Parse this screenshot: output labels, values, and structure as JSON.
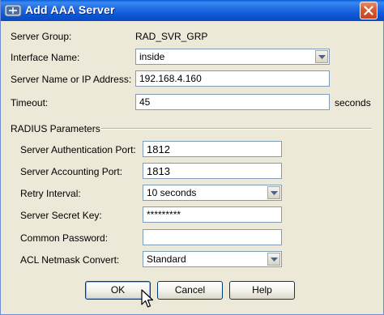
{
  "window": {
    "title": "Add AAA Server"
  },
  "form": {
    "server_group": {
      "label": "Server Group:",
      "value": "RAD_SVR_GRP"
    },
    "interface_name": {
      "label": "Interface Name:",
      "value": "inside"
    },
    "server_name": {
      "label": "Server Name or IP Address:",
      "value": "192.168.4.160"
    },
    "timeout": {
      "label": "Timeout:",
      "value": "45",
      "unit": "seconds"
    }
  },
  "radius": {
    "section_label": "RADIUS Parameters",
    "auth_port": {
      "label": "Server Authentication Port:",
      "value": "1812"
    },
    "acct_port": {
      "label": "Server Accounting Port:",
      "value": "1813"
    },
    "retry": {
      "label": "Retry Interval:",
      "value": "10 seconds"
    },
    "secret": {
      "label": "Server Secret Key:",
      "value": "*********"
    },
    "common_password": {
      "label": "Common Password:",
      "value": ""
    },
    "acl_netmask": {
      "label": "ACL Netmask Convert:",
      "value": "Standard"
    }
  },
  "buttons": {
    "ok": "OK",
    "cancel": "Cancel",
    "help": "Help"
  },
  "colors": {
    "titlebar": "#0a5ed8",
    "dialog_bg": "#ece9d8",
    "field_border": "#7f9db9"
  },
  "icons": {
    "title": "cisco-app-icon",
    "close": "close-icon",
    "dropdown": "chevron-down-icon",
    "cursor": "mouse-pointer-icon"
  }
}
